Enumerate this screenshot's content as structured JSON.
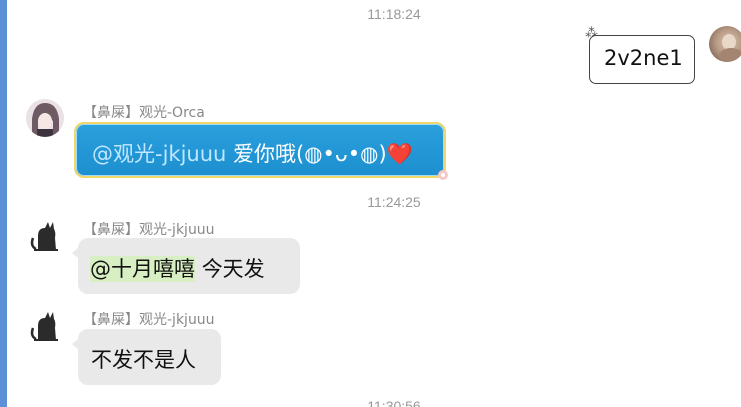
{
  "timestamps": [
    "11:18:24",
    "11:24:25",
    "11:30:56"
  ],
  "messages": [
    {
      "direction": "outgoing",
      "text": "2v2ne1",
      "avatar_icon": "user-photo-avatar"
    },
    {
      "direction": "incoming",
      "sender": "【鼻屎】观光-Orca",
      "mention": "@观光-jkjuuu",
      "text": "爱你哦(◍•ᴗ•◍)",
      "emoji": "❤️",
      "avatar_icon": "anime-girl-avatar",
      "bubble_style": "blue-decorated"
    },
    {
      "direction": "incoming",
      "sender": "【鼻屎】观光-jkjuuu",
      "mention": "@十月嘻嘻",
      "text": "今天发",
      "avatar_icon": "black-cat-avatar"
    },
    {
      "direction": "incoming",
      "sender": "【鼻屎】观光-jkjuuu",
      "text": "不发不是人",
      "avatar_icon": "black-cat-avatar"
    }
  ],
  "colors": {
    "accent_bar": "#5b8fd6",
    "bubble_gray": "#e9e9e9",
    "bubble_blue": "#1d8fd0",
    "mention_highlight": "#d7efc3",
    "timestamp": "#999999"
  }
}
